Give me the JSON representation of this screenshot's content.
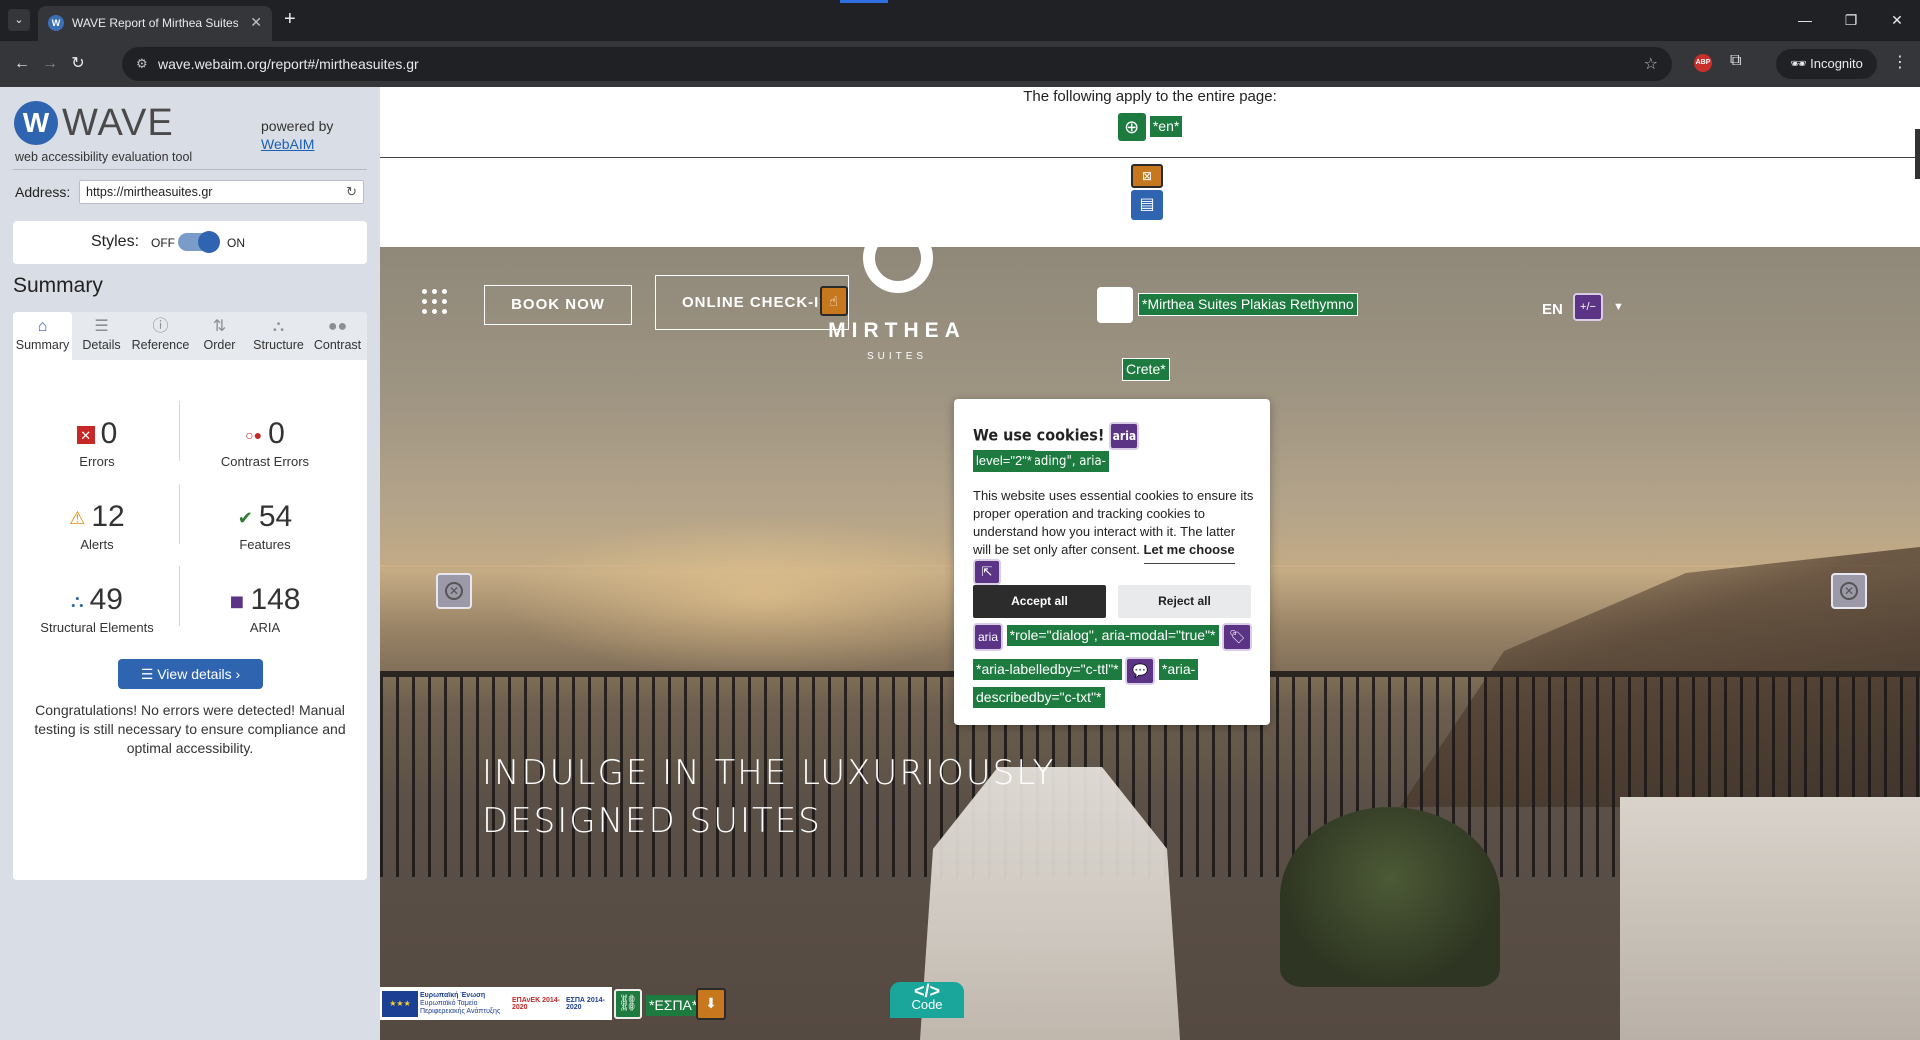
{
  "browser": {
    "tab_title": "WAVE Report of Mirthea Suites",
    "tab_favicon": "W",
    "url": "wave.webaim.org/report#/mirtheasuites.gr",
    "incognito_label": "Incognito",
    "abp_label": "ABP"
  },
  "wave": {
    "logo_word": "WAVE",
    "tagline": "web accessibility evaluation tool",
    "powered_by": "powered by",
    "webaim_link": "WebAIM",
    "address_label": "Address:",
    "address_value": "https://mirtheasuites.gr",
    "styles_label": "Styles:",
    "styles_off": "OFF",
    "styles_on": "ON",
    "summary_title": "Summary",
    "tabs": [
      "Summary",
      "Details",
      "Reference",
      "Order",
      "Structure",
      "Contrast"
    ],
    "stats": {
      "errors": {
        "value": "0",
        "label": "Errors"
      },
      "contrast_errors": {
        "value": "0",
        "label": "Contrast Errors"
      },
      "alerts": {
        "value": "12",
        "label": "Alerts"
      },
      "features": {
        "value": "54",
        "label": "Features"
      },
      "structural": {
        "value": "49",
        "label": "Structural Elements"
      },
      "aria": {
        "value": "148",
        "label": "ARIA"
      }
    },
    "view_details": "View details ›",
    "congrats": "Congratulations! No errors were detected! Manual testing is still necessary to ensure compliance and optimal accessibility."
  },
  "page": {
    "applies_text": "The following apply to the entire page:",
    "lang_tag": "*en*",
    "book_now": "BOOK NOW",
    "online_checkin": "ONLINE CHECK-IN",
    "brand_name": "MIRTHEA",
    "brand_sub": "SUITES",
    "alt_text_1": "*Mirthea Suites Plakias Rethymno",
    "alt_text_2": "Crete*",
    "lang_label": "EN",
    "aria_plusminus": "+/−",
    "hero_line1": "INDULGE IN THE LUXURIOUSLY",
    "hero_line2": "DESIGNED SUITES",
    "espa_label": "*ΕΣΠΑ*",
    "code_label": "Code",
    "code_icon": "</>"
  },
  "cookie_modal": {
    "heading": "We use cookies!",
    "aria_label": "aria",
    "heading_role_1": "*role=\"heading\", aria-",
    "heading_role_2": "level=\"2\"*",
    "body": "This website uses essential cookies to ensure its proper operation and tracking cookies to understand how you interact with it. The latter will be set only after consent.",
    "let_me_choose": "Let me choose",
    "accept": "Accept all",
    "reject": "Reject all",
    "dialog_role": "*role=\"dialog\", aria-modal=\"true\"*",
    "labelledby": "*aria-labelledby=\"c-ttl\"*",
    "describedby_1": "*aria-",
    "describedby_2": "describedby=\"c-txt\"*"
  },
  "eu_banner": {
    "union": "Ευρωπαϊκή Ένωση",
    "fund": "Ευρωπαϊκό Ταμείο Περιφερειακής Ανάπτυξης",
    "epanek": "ΕΠΑνΕΚ 2014-2020",
    "espa": "ΕΣΠΑ 2014-2020"
  }
}
